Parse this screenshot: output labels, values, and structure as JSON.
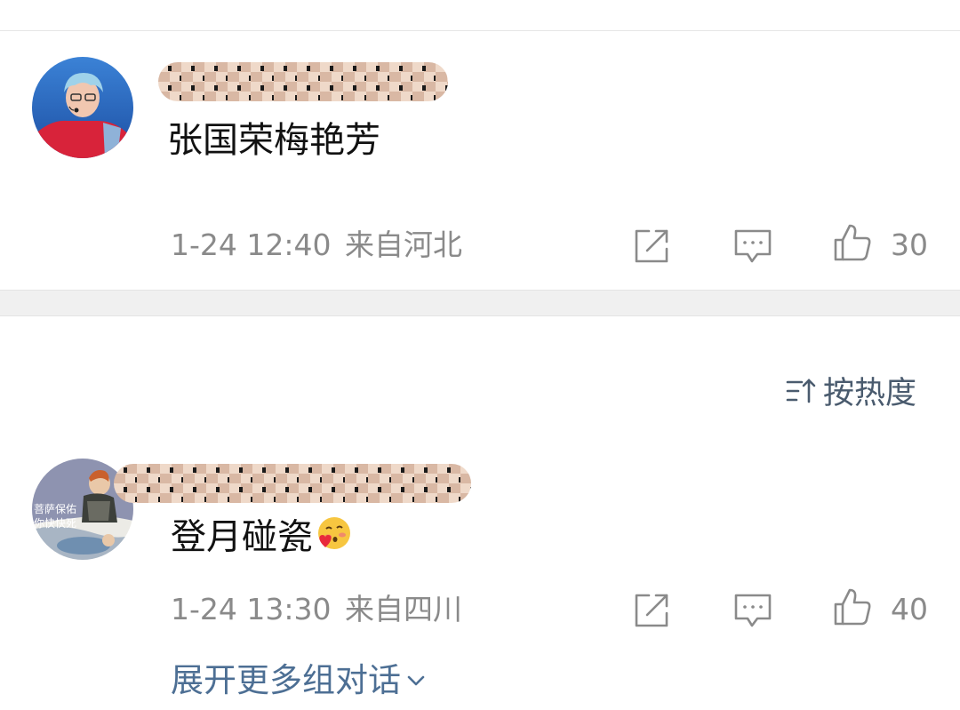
{
  "comments": [
    {
      "text": "张国荣梅艳芳",
      "time": "1-24 12:40",
      "location": "来自河北",
      "likes": "30",
      "avatar_icon": "avatar-concert-singer",
      "username_obscured": true
    },
    {
      "text": "登月碰瓷",
      "emoji": "blushing-heart-face-emoji",
      "time": "1-24 13:30",
      "location": "来自四川",
      "likes": "40",
      "avatar_icon": "avatar-cartoon",
      "avatar_caption": [
        "菩萨保佑",
        "你快快死"
      ],
      "username_obscured": true
    }
  ],
  "sort": {
    "label": "按热度",
    "icon": "sort-icon"
  },
  "expand": {
    "label": "展开更多组对话",
    "icon": "chevron-down-icon"
  },
  "colors": {
    "meta_text": "#8a8a8a",
    "link": "#4d6f94",
    "divider": "#f0f0f0"
  }
}
